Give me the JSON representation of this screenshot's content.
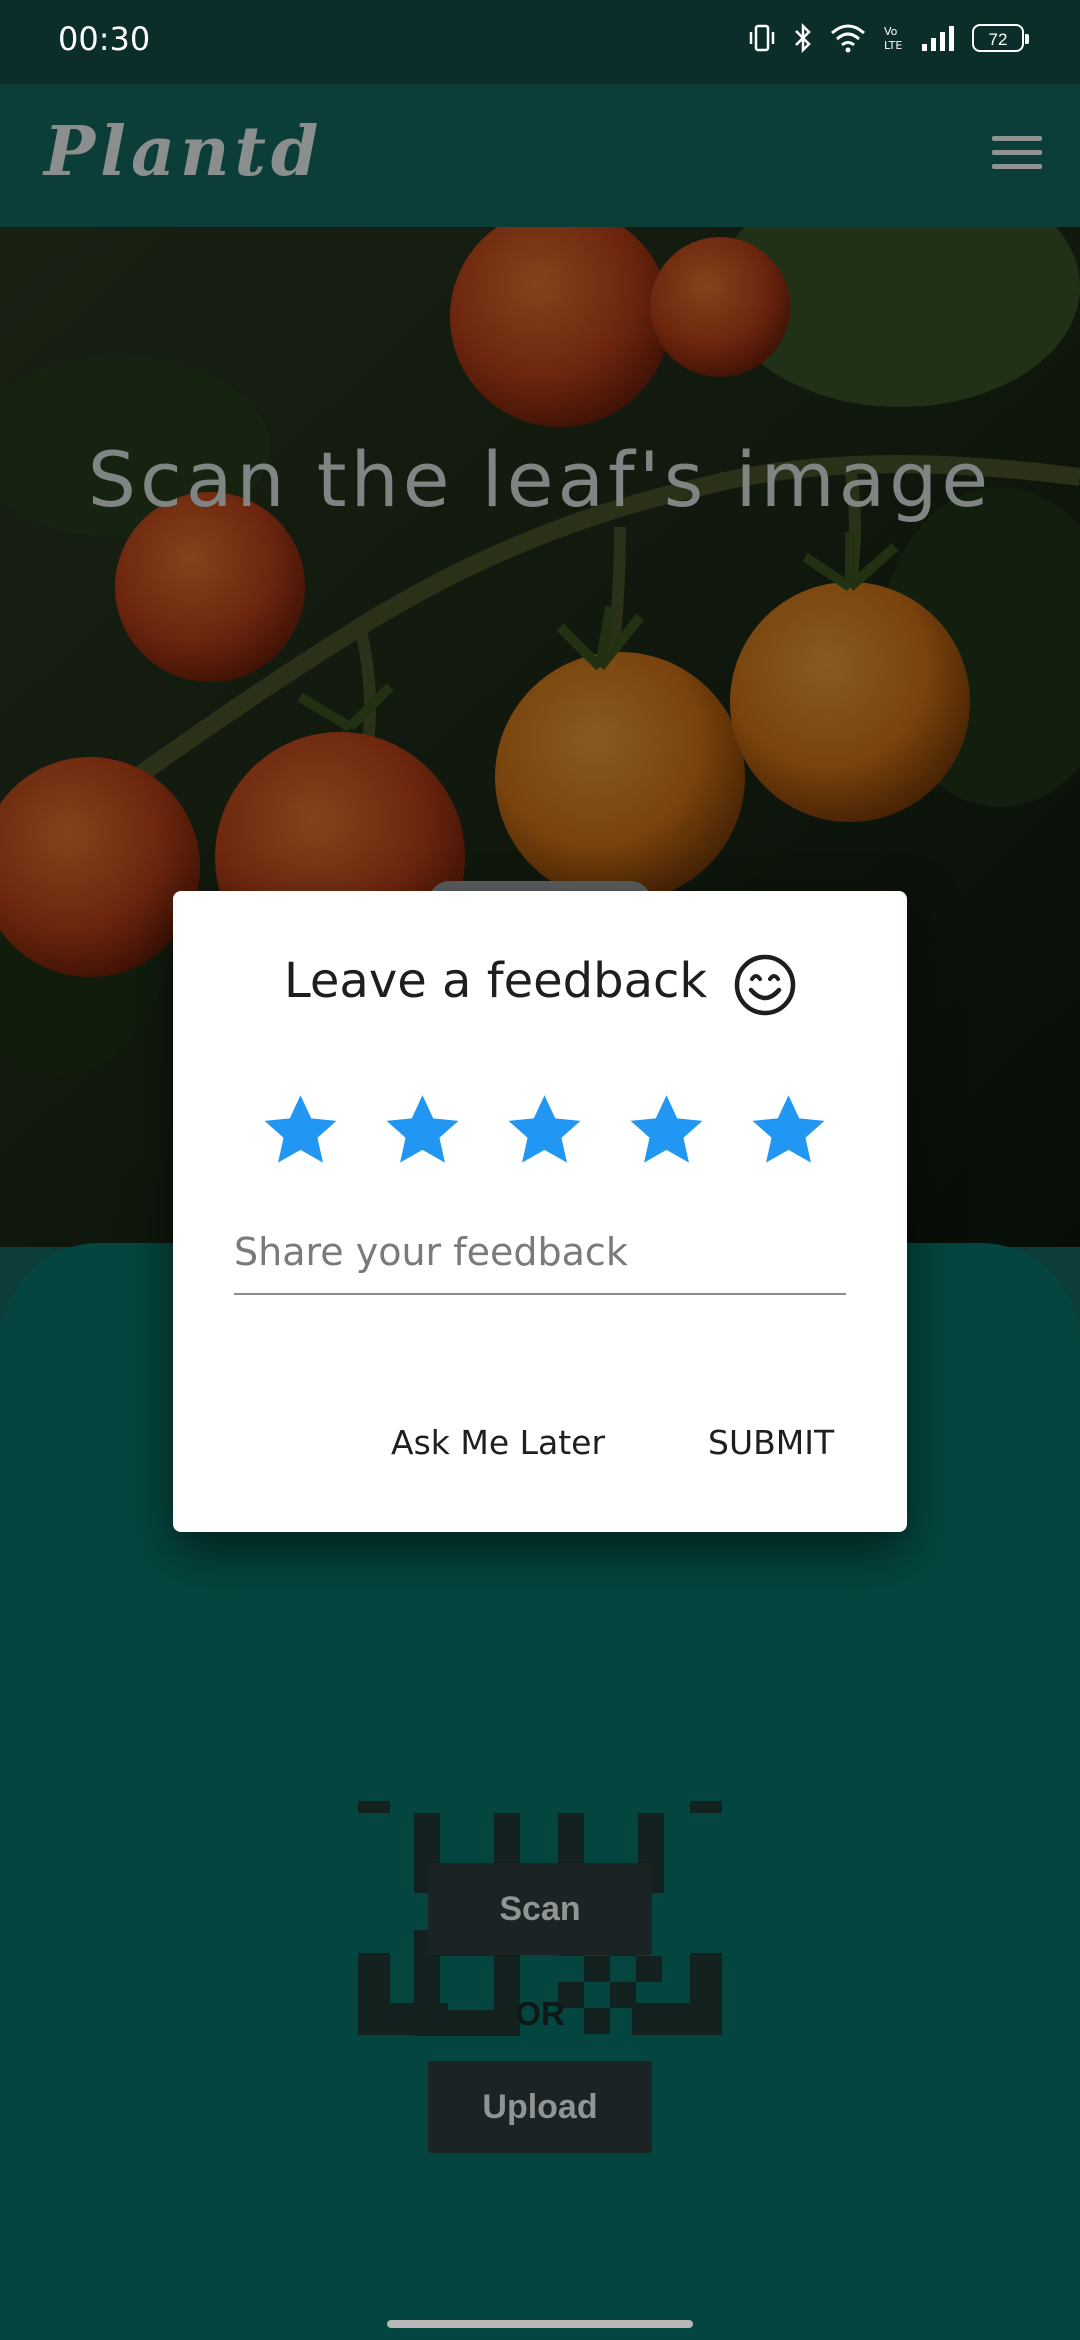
{
  "status_bar": {
    "time": "00:30",
    "battery_level": "72"
  },
  "app_bar": {
    "brand": "Plantd",
    "menu_icon": "hamburger-icon"
  },
  "hero": {
    "title": "Scan the leaf's image"
  },
  "panel": {
    "scan_label": "Scan",
    "or_label": "OR",
    "upload_label": "Upload",
    "qr_icon": "qr-code-icon"
  },
  "dialog": {
    "title": "Leave a feedback",
    "emoji_icon": "smiley-face-icon",
    "rating": 5,
    "max_rating": 5,
    "star_color": "#2196F3",
    "input": {
      "placeholder": "Share your feedback",
      "value": ""
    },
    "ask_later_label": "Ask Me Later",
    "submit_label": "SUBMIT"
  },
  "colors": {
    "app_bar": "#0c3e39",
    "panel": "#04463f",
    "button_bg": "#1b2324",
    "accent_star": "#2196F3"
  }
}
